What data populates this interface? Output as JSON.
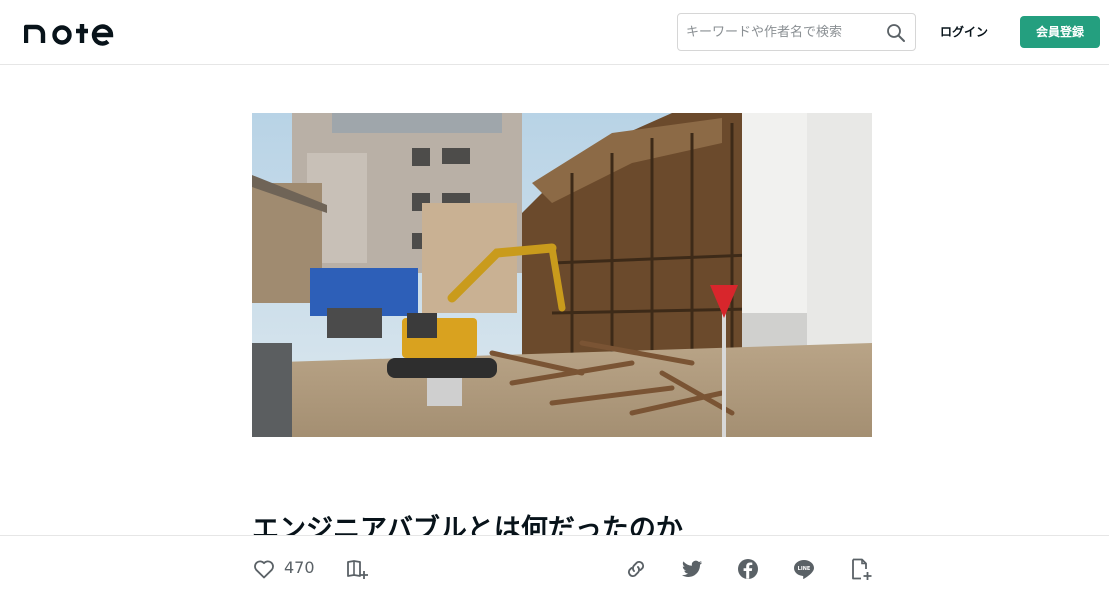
{
  "header": {
    "logo_text": "note",
    "search": {
      "placeholder": "キーワードや作者名で検索",
      "value": ""
    },
    "login_label": "ログイン",
    "signup_label": "会員登録"
  },
  "article": {
    "title": "エンジニアバブルとは何だったのか"
  },
  "actions": {
    "like_count": "470",
    "icons": [
      "heart-icon",
      "magazine-add-icon",
      "link-icon",
      "twitter-icon",
      "facebook-icon",
      "line-icon",
      "note-add-icon"
    ]
  },
  "colors": {
    "brand_green": "#249f7f",
    "text": "#08131a",
    "icon_gray": "#5a6166"
  }
}
